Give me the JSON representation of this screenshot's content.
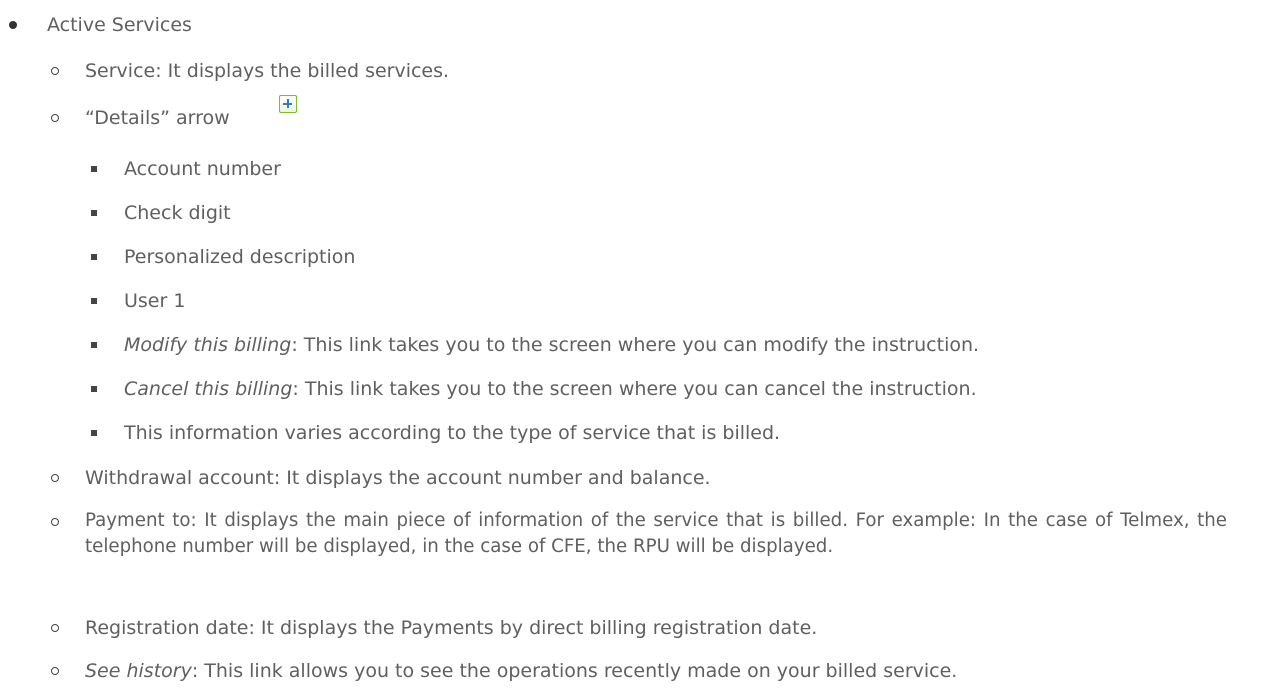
{
  "items": {
    "active_services": "Active Services",
    "service": "Service: It displays the billed services.",
    "details_arrow": "“Details” arrow",
    "account_number": "Account number",
    "check_digit": "Check digit",
    "personalized_description": "Personalized description",
    "user_1": "User 1",
    "modify_link": "Modify this billing",
    "modify_text": ": This link takes you to the screen where you can modify the instruction.",
    "cancel_link": "Cancel this billing",
    "cancel_text": ": This link takes you to the screen where you can cancel the instruction.",
    "info_varies": "This information varies according to the type of service that is billed.",
    "withdrawal_account": "Withdrawal account: It displays the account number and balance.",
    "payment_to": "Payment to: It displays the main piece of information of the service that is billed. For example: In the case of Telmex, the telephone number will be displayed, in the case of CFE, the RPU will be displayed.",
    "registration_date": "Registration date: It displays the  Payments by direct billing registration date.",
    "see_history_link": "See history",
    "see_history_text": ": This link allows you to see the operations recently made on your billed service."
  },
  "icons": {
    "details_toggle": "plus-icon"
  },
  "colors": {
    "text": "#5f5f5f",
    "icon_border": "#7db83a",
    "icon_plus": "#3a78c2"
  }
}
